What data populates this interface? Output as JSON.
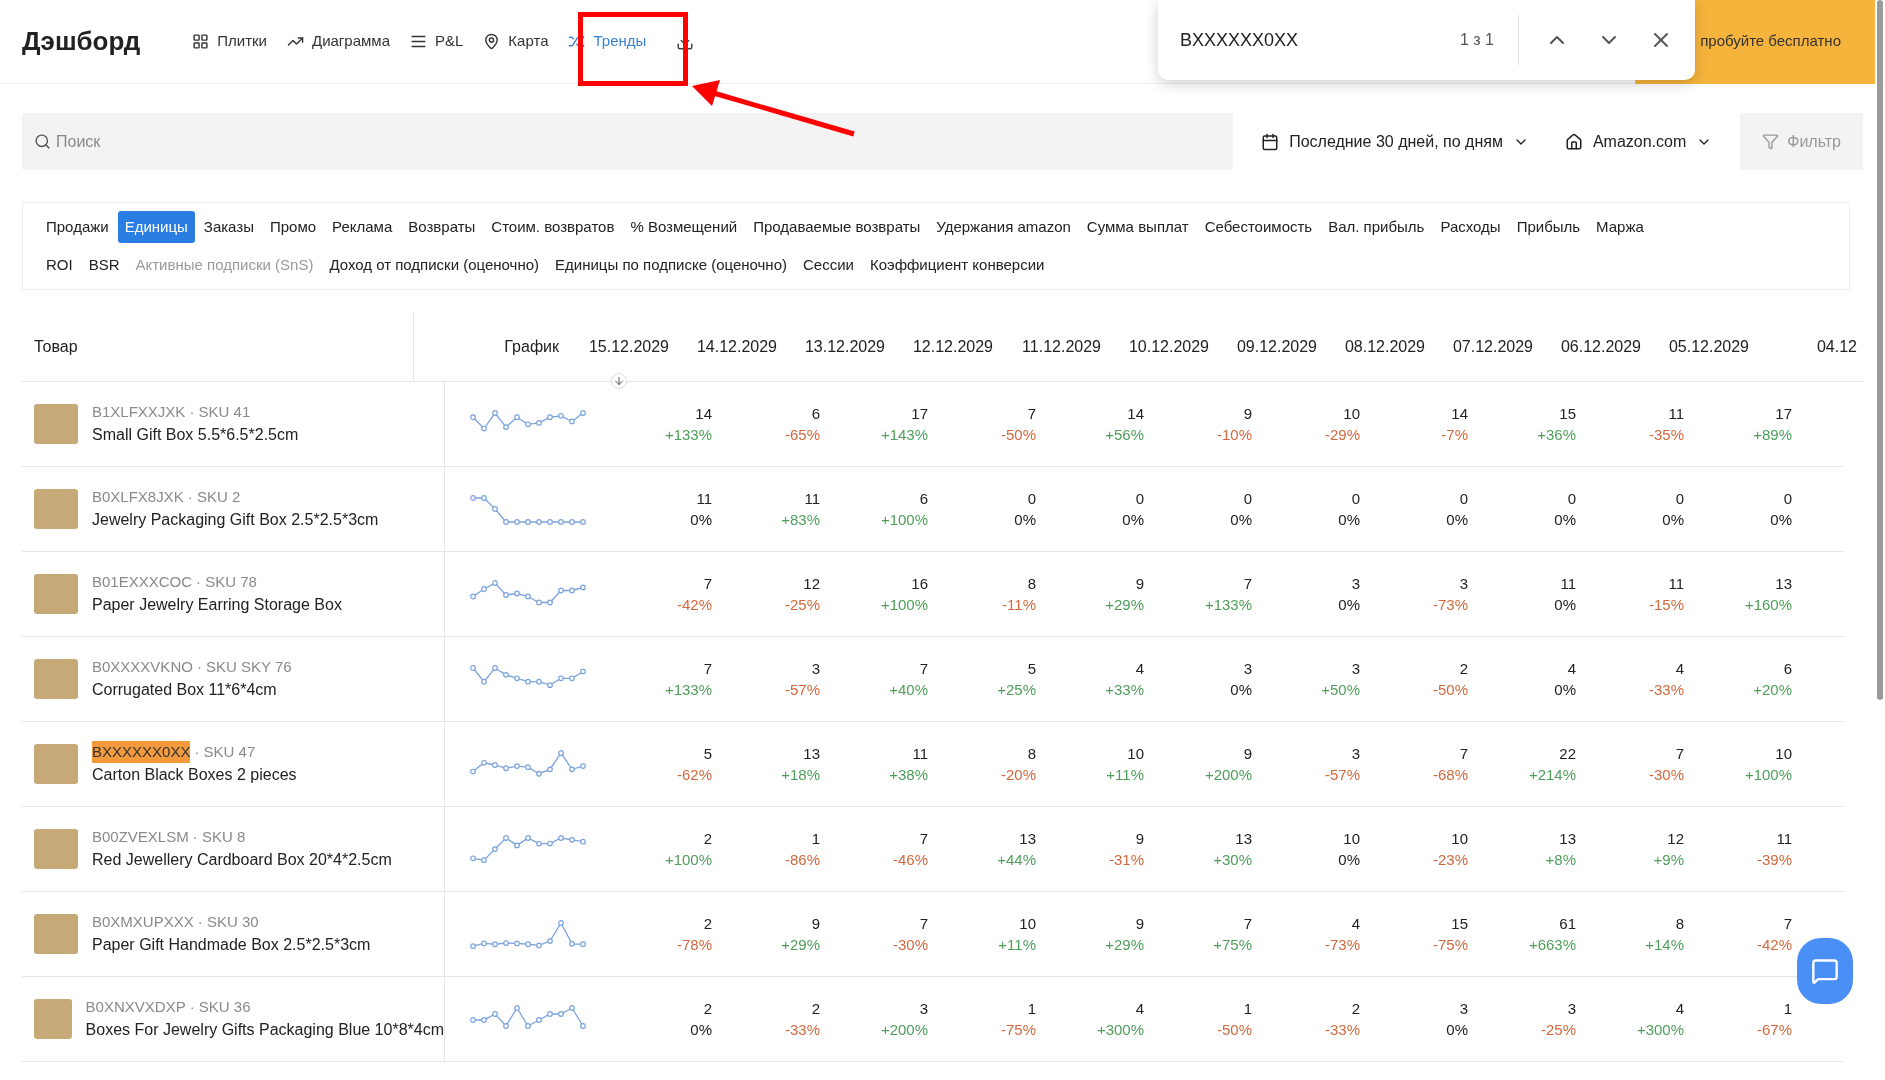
{
  "header": {
    "title": "Дэшборд",
    "trial_button": "пробуйте бесплатно",
    "nav": [
      {
        "label": "Плитки",
        "selected": false
      },
      {
        "label": "Диаграмма",
        "selected": false
      },
      {
        "label": "P&L",
        "selected": false
      },
      {
        "label": "Карта",
        "selected": false
      },
      {
        "label": "Тренды",
        "selected": true
      }
    ]
  },
  "find_bar": {
    "value": "BXXXXXX0XX",
    "count": "1 з 1"
  },
  "filters": {
    "search_placeholder": "Поиск",
    "period": "Последние 30 дней, по дням",
    "marketplace": "Amazon.com",
    "filter_button": "Фильтр"
  },
  "metric_rows": [
    [
      {
        "label": "Продажи",
        "selected": false,
        "disabled": false
      },
      {
        "label": "Единицы",
        "selected": true,
        "disabled": false
      },
      {
        "label": "Заказы",
        "selected": false,
        "disabled": false
      },
      {
        "label": "Промо",
        "selected": false,
        "disabled": false
      },
      {
        "label": "Реклама",
        "selected": false,
        "disabled": false
      },
      {
        "label": "Возвраты",
        "selected": false,
        "disabled": false
      },
      {
        "label": "Стоим. возвратов",
        "selected": false,
        "disabled": false
      },
      {
        "label": "% Возмещений",
        "selected": false,
        "disabled": false
      },
      {
        "label": "Продаваемые возвраты",
        "selected": false,
        "disabled": false
      },
      {
        "label": "Удержания amazon",
        "selected": false,
        "disabled": false
      },
      {
        "label": "Сумма выплат",
        "selected": false,
        "disabled": false
      },
      {
        "label": "Себестоимость",
        "selected": false,
        "disabled": false
      },
      {
        "label": "Вал. прибыль",
        "selected": false,
        "disabled": false
      },
      {
        "label": "Расходы",
        "selected": false,
        "disabled": false
      },
      {
        "label": "Прибыль",
        "selected": false,
        "disabled": false
      },
      {
        "label": "Маржа",
        "selected": false,
        "disabled": false
      }
    ],
    [
      {
        "label": "ROI",
        "selected": false,
        "disabled": false
      },
      {
        "label": "BSR",
        "selected": false,
        "disabled": false
      },
      {
        "label": "Активные подписки (SnS)",
        "selected": false,
        "disabled": true
      },
      {
        "label": "Доход от подписки (оценочно)",
        "selected": false,
        "disabled": false
      },
      {
        "label": "Единицы по подписке (оценочно)",
        "selected": false,
        "disabled": false
      },
      {
        "label": "Сессии",
        "selected": false,
        "disabled": false
      },
      {
        "label": "Коэффициент конверсии",
        "selected": false,
        "disabled": false
      }
    ]
  ],
  "table": {
    "product_column": "Товар",
    "chart_column": "График",
    "dates": [
      {
        "label": "15.12.2029",
        "sorted": true
      },
      {
        "label": "14.12.2029",
        "sorted": false
      },
      {
        "label": "13.12.2029",
        "sorted": false
      },
      {
        "label": "12.12.2029",
        "sorted": false
      },
      {
        "label": "11.12.2029",
        "sorted": false
      },
      {
        "label": "10.12.2029",
        "sorted": false
      },
      {
        "label": "09.12.2029",
        "sorted": false
      },
      {
        "label": "08.12.2029",
        "sorted": false
      },
      {
        "label": "07.12.2029",
        "sorted": false
      },
      {
        "label": "06.12.2029",
        "sorted": false
      },
      {
        "label": "05.12.2029",
        "sorted": false
      },
      {
        "label": "04.12",
        "sorted": false
      }
    ],
    "rows": [
      {
        "asin": "B1XLFXXJXK",
        "sku": "· SKU 41",
        "name": "Small Gift Box 5.5*6.5*2.5cm",
        "match": false,
        "cells": [
          {
            "value": "14",
            "change": "+133%",
            "kind": "up"
          },
          {
            "value": "6",
            "change": "-65%",
            "kind": "down"
          },
          {
            "value": "17",
            "change": "+143%",
            "kind": "up"
          },
          {
            "value": "7",
            "change": "-50%",
            "kind": "down"
          },
          {
            "value": "14",
            "change": "+56%",
            "kind": "up"
          },
          {
            "value": "9",
            "change": "-10%",
            "kind": "down"
          },
          {
            "value": "10",
            "change": "-29%",
            "kind": "down"
          },
          {
            "value": "14",
            "change": "-7%",
            "kind": "down"
          },
          {
            "value": "15",
            "change": "+36%",
            "kind": "up"
          },
          {
            "value": "11",
            "change": "-35%",
            "kind": "down"
          },
          {
            "value": "17",
            "change": "+89%",
            "kind": "up"
          }
        ]
      },
      {
        "asin": "B0XLFX8JXK",
        "sku": "· SKU 2",
        "name": "Jewelry Packaging Gift Box 2.5*2.5*3cm",
        "match": false,
        "cells": [
          {
            "value": "11",
            "change": "0%",
            "kind": "flat"
          },
          {
            "value": "11",
            "change": "+83%",
            "kind": "up"
          },
          {
            "value": "6",
            "change": "+100%",
            "kind": "up"
          },
          {
            "value": "0",
            "change": "0%",
            "kind": "flat"
          },
          {
            "value": "0",
            "change": "0%",
            "kind": "flat"
          },
          {
            "value": "0",
            "change": "0%",
            "kind": "flat"
          },
          {
            "value": "0",
            "change": "0%",
            "kind": "flat"
          },
          {
            "value": "0",
            "change": "0%",
            "kind": "flat"
          },
          {
            "value": "0",
            "change": "0%",
            "kind": "flat"
          },
          {
            "value": "0",
            "change": "0%",
            "kind": "flat"
          },
          {
            "value": "0",
            "change": "0%",
            "kind": "flat"
          }
        ]
      },
      {
        "asin": "B01EXXXCOC",
        "sku": "· SKU 78",
        "name": "Paper Jewelry Earring Storage Box",
        "match": false,
        "cells": [
          {
            "value": "7",
            "change": "-42%",
            "kind": "down"
          },
          {
            "value": "12",
            "change": "-25%",
            "kind": "down"
          },
          {
            "value": "16",
            "change": "+100%",
            "kind": "up"
          },
          {
            "value": "8",
            "change": "-11%",
            "kind": "down"
          },
          {
            "value": "9",
            "change": "+29%",
            "kind": "up"
          },
          {
            "value": "7",
            "change": "+133%",
            "kind": "up"
          },
          {
            "value": "3",
            "change": "0%",
            "kind": "flat"
          },
          {
            "value": "3",
            "change": "-73%",
            "kind": "down"
          },
          {
            "value": "11",
            "change": "0%",
            "kind": "flat"
          },
          {
            "value": "11",
            "change": "-15%",
            "kind": "down"
          },
          {
            "value": "13",
            "change": "+160%",
            "kind": "up"
          }
        ]
      },
      {
        "asin": "B0XXXXVKNO",
        "sku": "· SKU SKY 76",
        "name": "Corrugated Box 11*6*4cm",
        "match": false,
        "cells": [
          {
            "value": "7",
            "change": "+133%",
            "kind": "up"
          },
          {
            "value": "3",
            "change": "-57%",
            "kind": "down"
          },
          {
            "value": "7",
            "change": "+40%",
            "kind": "up"
          },
          {
            "value": "5",
            "change": "+25%",
            "kind": "up"
          },
          {
            "value": "4",
            "change": "+33%",
            "kind": "up"
          },
          {
            "value": "3",
            "change": "0%",
            "kind": "flat"
          },
          {
            "value": "3",
            "change": "+50%",
            "kind": "up"
          },
          {
            "value": "2",
            "change": "-50%",
            "kind": "down"
          },
          {
            "value": "4",
            "change": "0%",
            "kind": "flat"
          },
          {
            "value": "4",
            "change": "-33%",
            "kind": "down"
          },
          {
            "value": "6",
            "change": "+20%",
            "kind": "up"
          }
        ]
      },
      {
        "asin": "BXXXXXX0XX",
        "sku": "· SKU 47",
        "name": "Carton Black Boxes 2 pieces",
        "match": true,
        "cells": [
          {
            "value": "5",
            "change": "-62%",
            "kind": "down"
          },
          {
            "value": "13",
            "change": "+18%",
            "kind": "up"
          },
          {
            "value": "11",
            "change": "+38%",
            "kind": "up"
          },
          {
            "value": "8",
            "change": "-20%",
            "kind": "down"
          },
          {
            "value": "10",
            "change": "+11%",
            "kind": "up"
          },
          {
            "value": "9",
            "change": "+200%",
            "kind": "up"
          },
          {
            "value": "3",
            "change": "-57%",
            "kind": "down"
          },
          {
            "value": "7",
            "change": "-68%",
            "kind": "down"
          },
          {
            "value": "22",
            "change": "+214%",
            "kind": "up"
          },
          {
            "value": "7",
            "change": "-30%",
            "kind": "down"
          },
          {
            "value": "10",
            "change": "+100%",
            "kind": "up"
          }
        ]
      },
      {
        "asin": "B00ZVEXLSM",
        "sku": "· SKU 8",
        "name": "Red Jewellery Cardboard Box 20*4*2.5cm",
        "match": false,
        "cells": [
          {
            "value": "2",
            "change": "+100%",
            "kind": "up"
          },
          {
            "value": "1",
            "change": "-86%",
            "kind": "down"
          },
          {
            "value": "7",
            "change": "-46%",
            "kind": "down"
          },
          {
            "value": "13",
            "change": "+44%",
            "kind": "up"
          },
          {
            "value": "9",
            "change": "-31%",
            "kind": "down"
          },
          {
            "value": "13",
            "change": "+30%",
            "kind": "up"
          },
          {
            "value": "10",
            "change": "0%",
            "kind": "flat"
          },
          {
            "value": "10",
            "change": "-23%",
            "kind": "down"
          },
          {
            "value": "13",
            "change": "+8%",
            "kind": "up"
          },
          {
            "value": "12",
            "change": "+9%",
            "kind": "up"
          },
          {
            "value": "11",
            "change": "-39%",
            "kind": "down"
          }
        ]
      },
      {
        "asin": "B0XMXUPXXX",
        "sku": "· SKU 30",
        "name": "Paper Gift Handmade Box 2.5*2.5*3cm",
        "match": false,
        "cells": [
          {
            "value": "2",
            "change": "-78%",
            "kind": "down"
          },
          {
            "value": "9",
            "change": "+29%",
            "kind": "up"
          },
          {
            "value": "7",
            "change": "-30%",
            "kind": "down"
          },
          {
            "value": "10",
            "change": "+11%",
            "kind": "up"
          },
          {
            "value": "9",
            "change": "+29%",
            "kind": "up"
          },
          {
            "value": "7",
            "change": "+75%",
            "kind": "up"
          },
          {
            "value": "4",
            "change": "-73%",
            "kind": "down"
          },
          {
            "value": "15",
            "change": "-75%",
            "kind": "down"
          },
          {
            "value": "61",
            "change": "+663%",
            "kind": "up"
          },
          {
            "value": "8",
            "change": "+14%",
            "kind": "up"
          },
          {
            "value": "7",
            "change": "-42%",
            "kind": "down"
          }
        ]
      },
      {
        "asin": "B0XNXVXDXP",
        "sku": "· SKU 36",
        "name": "Boxes For Jewelry Gifts Packaging Blue 10*8*4cm",
        "match": false,
        "cells": [
          {
            "value": "2",
            "change": "0%",
            "kind": "flat"
          },
          {
            "value": "2",
            "change": "-33%",
            "kind": "down"
          },
          {
            "value": "3",
            "change": "+200%",
            "kind": "up"
          },
          {
            "value": "1",
            "change": "-75%",
            "kind": "down"
          },
          {
            "value": "4",
            "change": "+300%",
            "kind": "up"
          },
          {
            "value": "1",
            "change": "-50%",
            "kind": "down"
          },
          {
            "value": "2",
            "change": "-33%",
            "kind": "down"
          },
          {
            "value": "3",
            "change": "0%",
            "kind": "flat"
          },
          {
            "value": "3",
            "change": "-25%",
            "kind": "down"
          },
          {
            "value": "4",
            "change": "+300%",
            "kind": "up"
          },
          {
            "value": "1",
            "change": "-67%",
            "kind": "down"
          }
        ]
      }
    ]
  }
}
